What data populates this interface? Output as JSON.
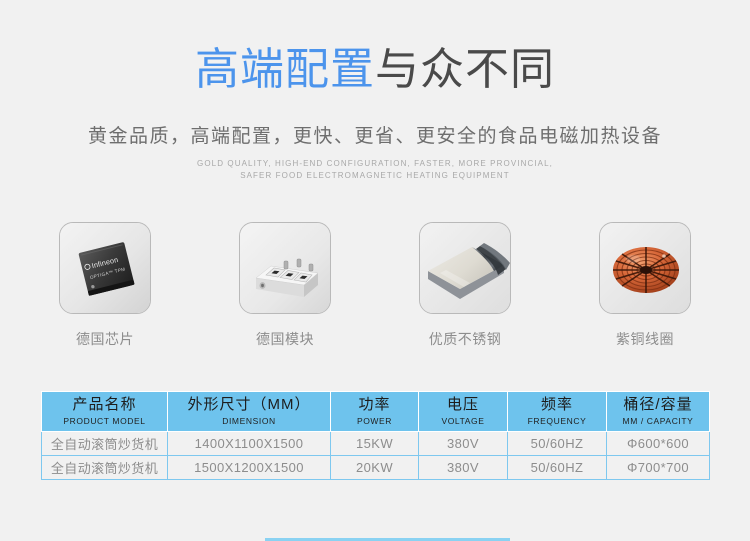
{
  "hero": {
    "title_blue": "高端配置",
    "title_dark": "与众不同",
    "subtitle_cn": "黄金品质，高端配置，更快、更省、更安全的食品电磁加热设备",
    "subtitle_en_line1": "GOLD QUALITY, HIGH-END CONFIGURATION, FASTER, MORE PROVINCIAL,",
    "subtitle_en_line2": "SAFER FOOD ELECTROMAGNETIC HEATING EQUIPMENT"
  },
  "features": [
    {
      "label": "德国芯片",
      "icon": "infineon-chip-icon",
      "chip_brand": "Infineon",
      "chip_model": "OPTIGA™ TPM"
    },
    {
      "label": "德国模块",
      "icon": "igbt-power-module-icon"
    },
    {
      "label": "优质不锈钢",
      "icon": "stainless-steel-sheet-icon"
    },
    {
      "label": "紫铜线圈",
      "icon": "copper-coil-icon"
    }
  ],
  "spec_table": {
    "headers": [
      {
        "cn": "产品名称",
        "en": "PRODUCT MODEL"
      },
      {
        "cn": "外形尺寸（MM）",
        "en": "DIMENSION"
      },
      {
        "cn": "功率",
        "en": "POWER"
      },
      {
        "cn": "电压",
        "en": "VOLTAGE"
      },
      {
        "cn": "频率",
        "en": "FREQUENCY"
      },
      {
        "cn": "桶径/容量",
        "en": "MM / CAPACITY"
      }
    ],
    "rows": [
      {
        "product": "全自动滚筒炒货机",
        "dimension": "1400X1100X1500",
        "power": "15KW",
        "voltage": "380V",
        "frequency": "50/60HZ",
        "capacity": "Φ600*600"
      },
      {
        "product": "全自动滚筒炒货机",
        "dimension": "1500X1200X1500",
        "power": "20KW",
        "voltage": "380V",
        "frequency": "50/60HZ",
        "capacity": "Φ700*700"
      }
    ]
  },
  "colors": {
    "accent_blue": "#4c94ec",
    "table_header_blue": "#6ec3ed",
    "table_border_blue": "#7ec8ef",
    "bottom_bar_blue": "#8ad2f2",
    "page_background": "#f1f1f1",
    "muted_text": "#8d8d8d"
  }
}
